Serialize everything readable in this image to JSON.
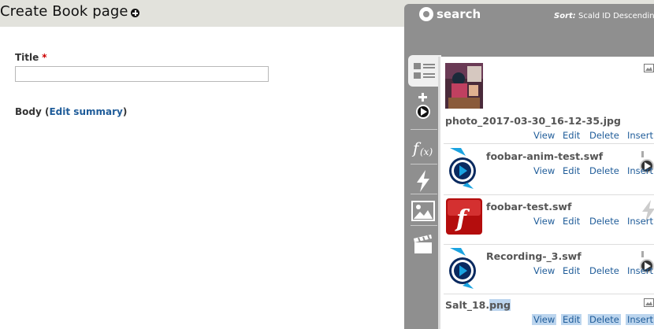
{
  "page": {
    "title": "Create Book page"
  },
  "form": {
    "title_label": "Title",
    "required_mark": "*",
    "title_value": "",
    "body_label": "Body",
    "edit_summary_link": "Edit summary"
  },
  "scald": {
    "search_label": "search",
    "sort_prefix": "Sort:",
    "sort_value": "Scald ID Descending",
    "tabs": [
      "list-view",
      "add-video",
      "formula",
      "flash",
      "image",
      "video"
    ],
    "action_labels": {
      "view": "View",
      "edit": "Edit",
      "delete": "Delete",
      "insert": "Insert"
    },
    "atoms": [
      {
        "title": "photo_2017-03-30_16-12-35.jpg",
        "type": "image",
        "selected": false
      },
      {
        "title": "foobar-anim-test.swf",
        "type": "video",
        "selected": false
      },
      {
        "title": "foobar-test.swf",
        "type": "flash",
        "selected": false
      },
      {
        "title": "Recording-_3.swf",
        "type": "video",
        "selected": false
      },
      {
        "title_plain": "Salt_18.",
        "title_selected": "png",
        "type": "image",
        "selected": true
      }
    ],
    "colors": {
      "panel": "#8f8f8f",
      "link": "#1f5c99",
      "selection": "#bcd5ee",
      "required": "#cc0000"
    }
  }
}
